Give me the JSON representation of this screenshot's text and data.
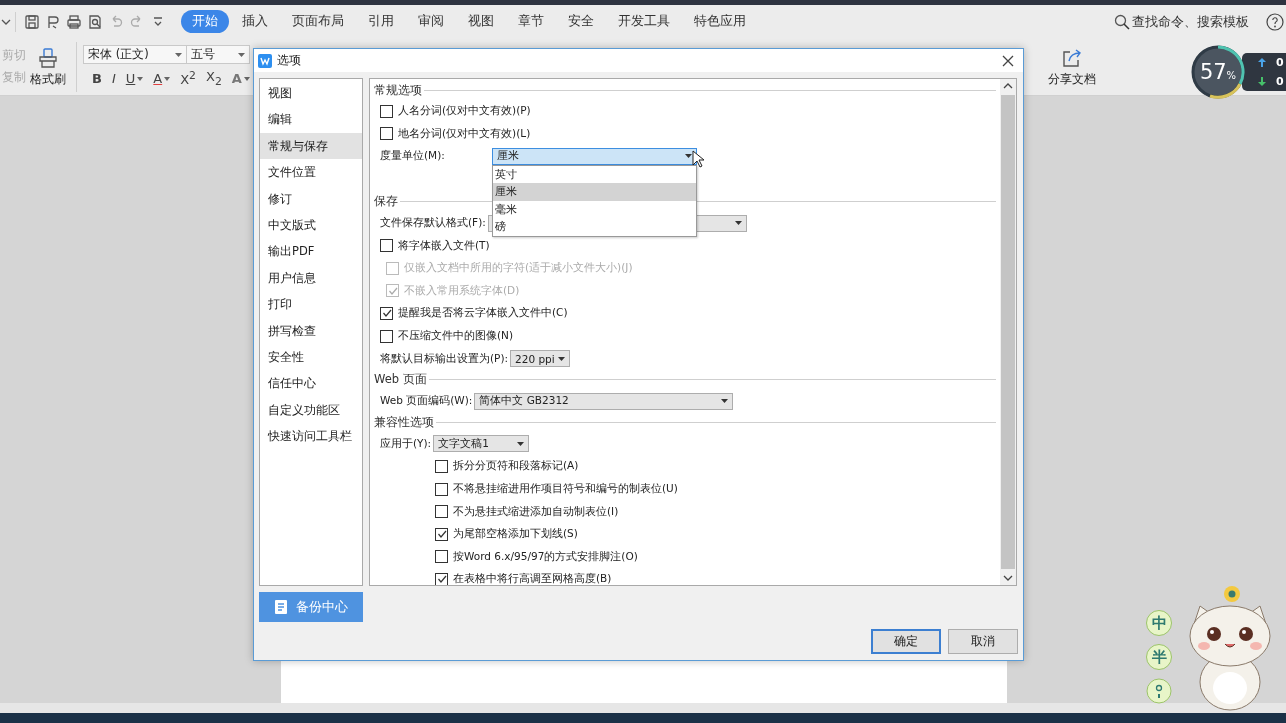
{
  "menu_bar": {
    "tabs": [
      {
        "label": "开始",
        "selected": true
      },
      {
        "label": "插入",
        "selected": false
      },
      {
        "label": "页面布局",
        "selected": false
      },
      {
        "label": "引用",
        "selected": false
      },
      {
        "label": "审阅",
        "selected": false
      },
      {
        "label": "视图",
        "selected": false
      },
      {
        "label": "章节",
        "selected": false
      },
      {
        "label": "安全",
        "selected": false
      },
      {
        "label": "开发工具",
        "selected": false
      },
      {
        "label": "特色应用",
        "selected": false
      }
    ],
    "search": {
      "placeholder": "查找命令、搜索模板"
    }
  },
  "ribbon": {
    "clipboard": [
      {
        "label": "剪切",
        "disabled": true
      },
      {
        "label": "复制",
        "disabled": true
      }
    ],
    "format_painter": "格式刷",
    "font": "宋体 (正文)",
    "font_size": "五号",
    "format_buttons": [
      {
        "label": "B",
        "kind": "bold",
        "caret": false
      },
      {
        "label": "I",
        "kind": "italic",
        "caret": false
      },
      {
        "label": "U",
        "kind": "underline",
        "caret": true
      },
      {
        "label": "A",
        "kind": "color",
        "caret": true
      },
      {
        "label": "X$^{2}$",
        "kind": "plain",
        "caret": false
      },
      {
        "label": "X$_{2}$",
        "kind": "plain",
        "caret": false
      },
      {
        "label": "A",
        "kind": "outline",
        "caret": true
      }
    ],
    "share": "分享文档"
  },
  "net_meter": {
    "percent": "57",
    "unit": "%",
    "up": "0",
    "down": "0"
  },
  "dialog": {
    "title": "选项",
    "nav": [
      {
        "label": "视图",
        "selected": false
      },
      {
        "label": "编辑",
        "selected": false
      },
      {
        "label": "常规与保存",
        "selected": true
      },
      {
        "label": "文件位置",
        "selected": false
      },
      {
        "label": "修订",
        "selected": false
      },
      {
        "label": "中文版式",
        "selected": false
      },
      {
        "label": "输出PDF",
        "selected": false
      },
      {
        "label": "用户信息",
        "selected": false
      },
      {
        "label": "打印",
        "selected": false
      },
      {
        "label": "拼写检查",
        "selected": false
      },
      {
        "label": "安全性",
        "selected": false
      },
      {
        "label": "信任中心",
        "selected": false
      },
      {
        "label": "自定义功能区",
        "selected": false
      },
      {
        "label": "快速访问工具栏",
        "selected": false
      }
    ],
    "backup": "备份中心",
    "sections": [
      {
        "title": "常规选项",
        "items": [
          {
            "kind": "checkbox",
            "label": "人名分词(仅对中文有效)(P)",
            "checked": false,
            "disabled": false
          },
          {
            "kind": "checkbox",
            "label": "地名分词(仅对中文有效)(L)",
            "checked": false,
            "disabled": false
          },
          {
            "kind": "select",
            "label": "度量单位(M):",
            "value": "厘米",
            "expanded": true,
            "options": [
              {
                "label": "英寸",
                "selected": false
              },
              {
                "label": "厘米",
                "selected": true
              },
              {
                "label": "毫米",
                "selected": false
              },
              {
                "label": "磅",
                "selected": false
              }
            ]
          }
        ]
      },
      {
        "title": "保存",
        "items": [
          {
            "kind": "select",
            "label": "文件保存默认格式(F):",
            "expanded": false
          },
          {
            "kind": "checkbox",
            "label": "将字体嵌入文件(T)",
            "checked": false,
            "disabled": false,
            "children": [
              {
                "kind": "checkbox",
                "label": "仅嵌入文档中所用的字符(适于减小文件大小)(J)",
                "checked": false,
                "disabled": true
              },
              {
                "kind": "checkbox",
                "label": "不嵌入常用系统字体(D)",
                "checked": true,
                "disabled": true
              }
            ]
          },
          {
            "kind": "checkbox",
            "label": "提醒我是否将云字体嵌入文件中(C)",
            "checked": true,
            "disabled": false
          },
          {
            "kind": "checkbox",
            "label": "不压缩文件中的图像(N)",
            "checked": false,
            "disabled": false
          },
          {
            "kind": "select",
            "label": "将默认目标输出设置为(P):",
            "value": "220 ppi",
            "expanded": false
          }
        ]
      },
      {
        "title": "Web 页面",
        "items": [
          {
            "kind": "select",
            "label": "Web 页面编码(W):",
            "value": "简体中文 GB2312",
            "expanded": false
          }
        ]
      },
      {
        "title": "兼容性选项",
        "items": [
          {
            "kind": "select",
            "label": "应用于(Y):",
            "value": "文字文稿1",
            "expanded": false,
            "children": [
              {
                "kind": "checkbox",
                "label": "拆分分页符和段落标记(A)",
                "checked": false,
                "disabled": false
              },
              {
                "kind": "checkbox",
                "label": "不将悬挂缩进用作项目符号和编号的制表位(U)",
                "checked": false,
                "disabled": false
              },
              {
                "kind": "checkbox",
                "label": "不为悬挂式缩进添加自动制表位(I)",
                "checked": false,
                "disabled": false
              },
              {
                "kind": "checkbox",
                "label": "为尾部空格添加下划线(S)",
                "checked": true,
                "disabled": false
              },
              {
                "kind": "checkbox",
                "label": "按Word 6.x/95/97的方式安排脚注(O)",
                "checked": false,
                "disabled": false
              },
              {
                "kind": "checkbox",
                "label": "在表格中将行高调至网格高度(B)",
                "checked": true,
                "disabled": false
              }
            ]
          }
        ]
      }
    ],
    "buttons": [
      {
        "label": "确定",
        "default": true
      },
      {
        "label": "取消",
        "default": false
      }
    ]
  },
  "ime_bar": [
    {
      "label": "中",
      "kind": "text"
    },
    {
      "label": "半",
      "kind": "text"
    },
    {
      "kind": "punctuation"
    }
  ]
}
